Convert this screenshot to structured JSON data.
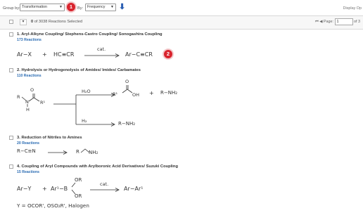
{
  "toolbar": {
    "group_by_label": "Group by:",
    "group_by_value": "Transformation",
    "by_label": "By:",
    "by_value": "Frequency",
    "display_options": "Display Op",
    "callout_1": "1"
  },
  "selection": {
    "selected": "0",
    "summary": "of 3038 Reactions Selected"
  },
  "pager": {
    "page_label": "Page:",
    "page_value": "1",
    "of_label": "of 3"
  },
  "reactions": [
    {
      "title": "1. Aryl-Alkyne Coupling/ Stephens-Castro Coupling/ Sonogashira Coupling",
      "count": "173 Reactions"
    },
    {
      "title": "2. Hydrolysis or Hydrogenolysis of Amides/ Imides/ Carbamates",
      "count": "110 Reactions"
    },
    {
      "title": "3. Reduction of Nitriles to Amines",
      "count": "20 Reactions"
    },
    {
      "title": "4. Coupling of Aryl Compounds with Arylboronic Acid Derivatives/ Suzuki Coupling",
      "count": "15 Reactions"
    }
  ],
  "schemes": {
    "r1_reactant1": "Ar−X",
    "plus": "+",
    "r1_reactant2": "HC≡CR",
    "cat": "cat.",
    "r1_product": "Ar−C≡CR",
    "callout_2": "2",
    "r2_h2o": "H₂O",
    "r2_h2": "H₂",
    "r2_amine": "R−NH₂",
    "r2_amine2": "R−NH₂",
    "r2_acid_r": "R¹",
    "r2_acid_oh": "OH",
    "r2_o": "O",
    "r2_o2": "O",
    "r2_r": "R",
    "r2_n": "N",
    "r2_r1": "R¹",
    "r2_h": "H",
    "r3_reactant": "R−C≡N",
    "r3_product_r": "R",
    "r3_product_nh2": "NH₂",
    "r4_reactant1": "Ar−Y",
    "r4_reactant2": "Ar¹−B",
    "r4_or_top": "OR",
    "r4_or_bottom": "OR",
    "r4_product": "Ar−Ar¹",
    "r4_note": "Y = OCOR', OSO₂R', Halogen"
  },
  "colors": {
    "callout": "#d9232d",
    "link": "#2b6cb3"
  }
}
